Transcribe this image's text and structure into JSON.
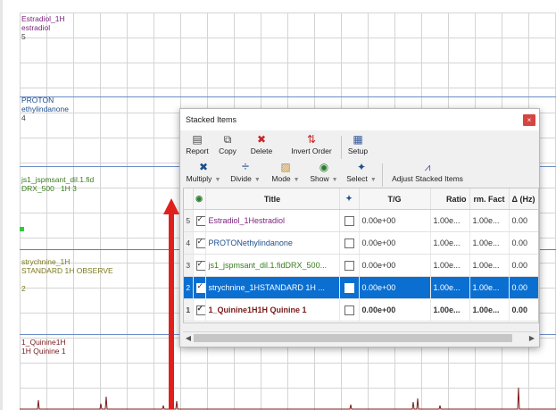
{
  "spectra": [
    {
      "name_line": "Estradiol_1H",
      "desc_line": "estradiol",
      "index": "5",
      "color": "#7b1f7b"
    },
    {
      "name_line": "PROTON",
      "desc_line": "ethylindanone",
      "index": "4",
      "color": "#1f4e8c"
    },
    {
      "name_line": "js1_jspmsant_dil.1.fid",
      "desc_line": "DRX_500   1H 3",
      "index": "",
      "color": "#3a7d1e"
    },
    {
      "name_line": "strychnine_1H",
      "desc_line": "STANDARD 1H OBSERVE",
      "index": "2",
      "color": "#7a7a1a"
    },
    {
      "name_line": "1_Quinine1H",
      "desc_line": "1H Quinine 1",
      "index": "",
      "color": "#7a1a1a"
    }
  ],
  "dialog": {
    "title": "Stacked Items",
    "close_glyph": "×",
    "toolbar1": [
      {
        "label": "Report",
        "icon": "report-icon",
        "glyph": "▤",
        "color": "#444"
      },
      {
        "label": "Copy",
        "icon": "copy-icon",
        "glyph": "⧉",
        "color": "#444"
      },
      {
        "label": "Delete",
        "icon": "delete-icon",
        "glyph": "✖",
        "color": "#c62828"
      },
      {
        "label": "Invert Order",
        "icon": "invert-order-icon",
        "glyph": "⇅",
        "color": "#c62828"
      },
      {
        "label": "Setup",
        "icon": "setup-icon",
        "glyph": "▦",
        "color": "#2f5597"
      }
    ],
    "toolbar2": [
      {
        "label": "Multiply",
        "icon": "multiply-icon",
        "glyph": "✖",
        "color": "#1f4e8c"
      },
      {
        "label": "Divide",
        "icon": "divide-icon",
        "glyph": "÷",
        "color": "#1f4e8c"
      },
      {
        "label": "Mode",
        "icon": "mode-icon",
        "glyph": "▨",
        "color": "#c08a2a"
      },
      {
        "label": "Show",
        "icon": "eye-icon",
        "glyph": "◉",
        "color": "#2e7d32"
      },
      {
        "label": "Select",
        "icon": "pin-icon",
        "glyph": "✦",
        "color": "#1f4e8c"
      },
      {
        "label": "Adjust Stacked Items",
        "icon": "adjust-stacked-icon",
        "glyph": "⩘",
        "color": "#6a4fb3"
      }
    ],
    "table": {
      "headers": [
        "",
        "",
        "Title",
        "",
        "T/G",
        "Ratio",
        "rm. Fact",
        "Δ (Hz)"
      ],
      "rows": [
        {
          "idx": "5",
          "checked": true,
          "title": "Estradiol_1Hestradiol",
          "pinned": false,
          "tg": "0.00e+00",
          "ratio": "1.00e...",
          "norm": "1.00e...",
          "delta": "0.00",
          "title_color": "#7b1f7b"
        },
        {
          "idx": "4",
          "checked": true,
          "title": "PROTONethylindanone",
          "pinned": false,
          "tg": "0.00e+00",
          "ratio": "1.00e...",
          "norm": "1.00e...",
          "delta": "0.00",
          "title_color": "#1f4e8c"
        },
        {
          "idx": "3",
          "checked": true,
          "title": "js1_jspmsant_dil.1.fidDRX_500...",
          "pinned": false,
          "tg": "0.00e+00",
          "ratio": "1.00e...",
          "norm": "1.00e...",
          "delta": "0.00",
          "title_color": "#3a7d1e"
        },
        {
          "idx": "2",
          "checked": true,
          "title": "strychnine_1HSTANDARD 1H ...",
          "pinned": false,
          "tg": "0.00e+00",
          "ratio": "1.00e...",
          "norm": "1.00e...",
          "delta": "0.00",
          "title_color": "#ffffff"
        },
        {
          "idx": "1",
          "checked": true,
          "title": "1_Quinine1H1H Quinine 1",
          "pinned": false,
          "tg": "0.00e+00",
          "ratio": "1.00e...",
          "norm": "1.00e...",
          "delta": "0.00",
          "title_color": "#7a1a1a"
        }
      ]
    }
  }
}
